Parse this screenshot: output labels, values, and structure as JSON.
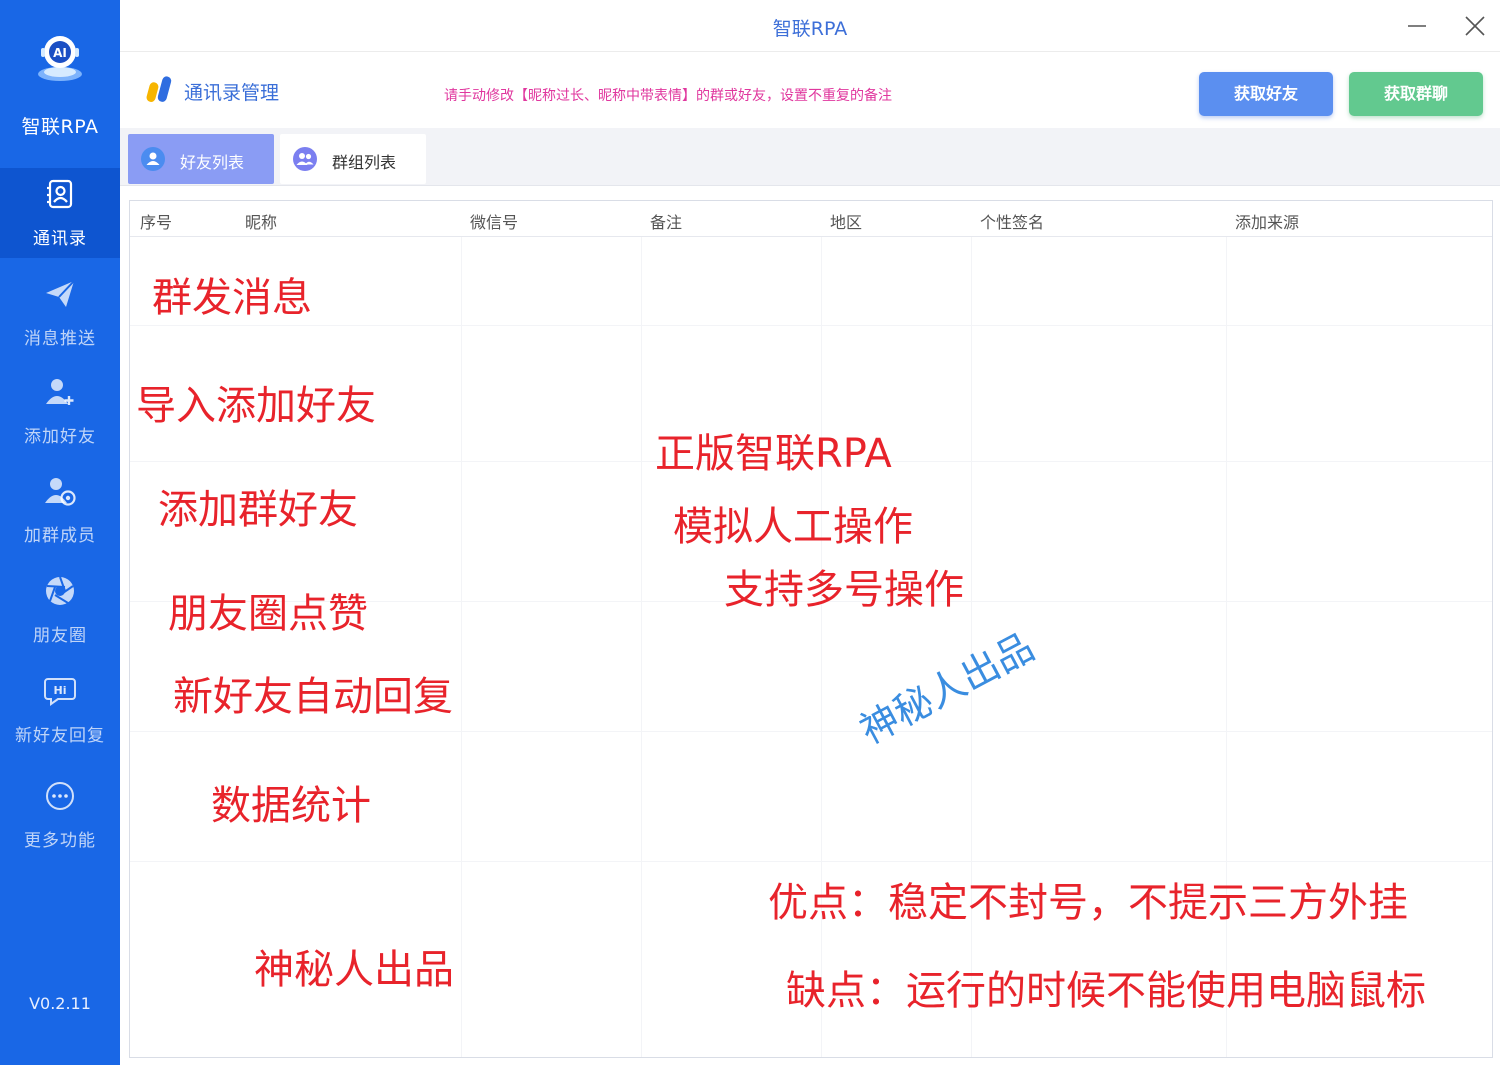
{
  "app": {
    "window_title": "智联RPA",
    "brand_name": "智联RPA",
    "version": "V0.2.11"
  },
  "sidebar": {
    "items": [
      {
        "label": "通讯录",
        "icon": "contacts-icon",
        "active": true
      },
      {
        "label": "消息推送",
        "icon": "paper-plane-icon",
        "active": false
      },
      {
        "label": "添加好友",
        "icon": "add-user-icon",
        "active": false
      },
      {
        "label": "加群成员",
        "icon": "group-member-icon",
        "active": false
      },
      {
        "label": "朋友圈",
        "icon": "aperture-icon",
        "active": false
      },
      {
        "label": "新好友回复",
        "icon": "hi-chat-icon",
        "active": false
      },
      {
        "label": "更多功能",
        "icon": "more-icon",
        "active": false
      }
    ]
  },
  "header": {
    "title": "通讯录管理",
    "notice": "请手动修改【昵称过长、昵称中带表情】的群或好友，设置不重复的备注",
    "buttons": {
      "get_friends": "获取好友",
      "get_groups": "获取群聊"
    }
  },
  "tabs": [
    {
      "label": "好友列表",
      "active": true
    },
    {
      "label": "群组列表",
      "active": false
    }
  ],
  "table": {
    "columns": [
      "序号",
      "昵称",
      "微信号",
      "备注",
      "地区",
      "个性签名",
      "添加来源"
    ]
  },
  "annotations": {
    "features": [
      "群发消息",
      "导入添加好友",
      "添加群好友",
      "朋友圈点赞",
      "新好友自动回复",
      "数据统计"
    ],
    "signature_bottom": "神秘人出品",
    "highlights": [
      "正版智联RPA",
      "模拟人工操作",
      "支持多号操作"
    ],
    "watermark": "神秘人出品",
    "pros": "优点：稳定不封号，不提示三方外挂",
    "cons": "缺点：运行的时候不能使用电脑鼠标"
  },
  "colors": {
    "sidebar_bg": "#1967e6",
    "accent_blue": "#3b6fd8",
    "notice_pink": "#e0379e",
    "btn_friends": "#5b8ff0",
    "btn_groups": "#62c98f",
    "annotation_red": "#e8232b",
    "watermark_blue": "#3a8de0"
  }
}
